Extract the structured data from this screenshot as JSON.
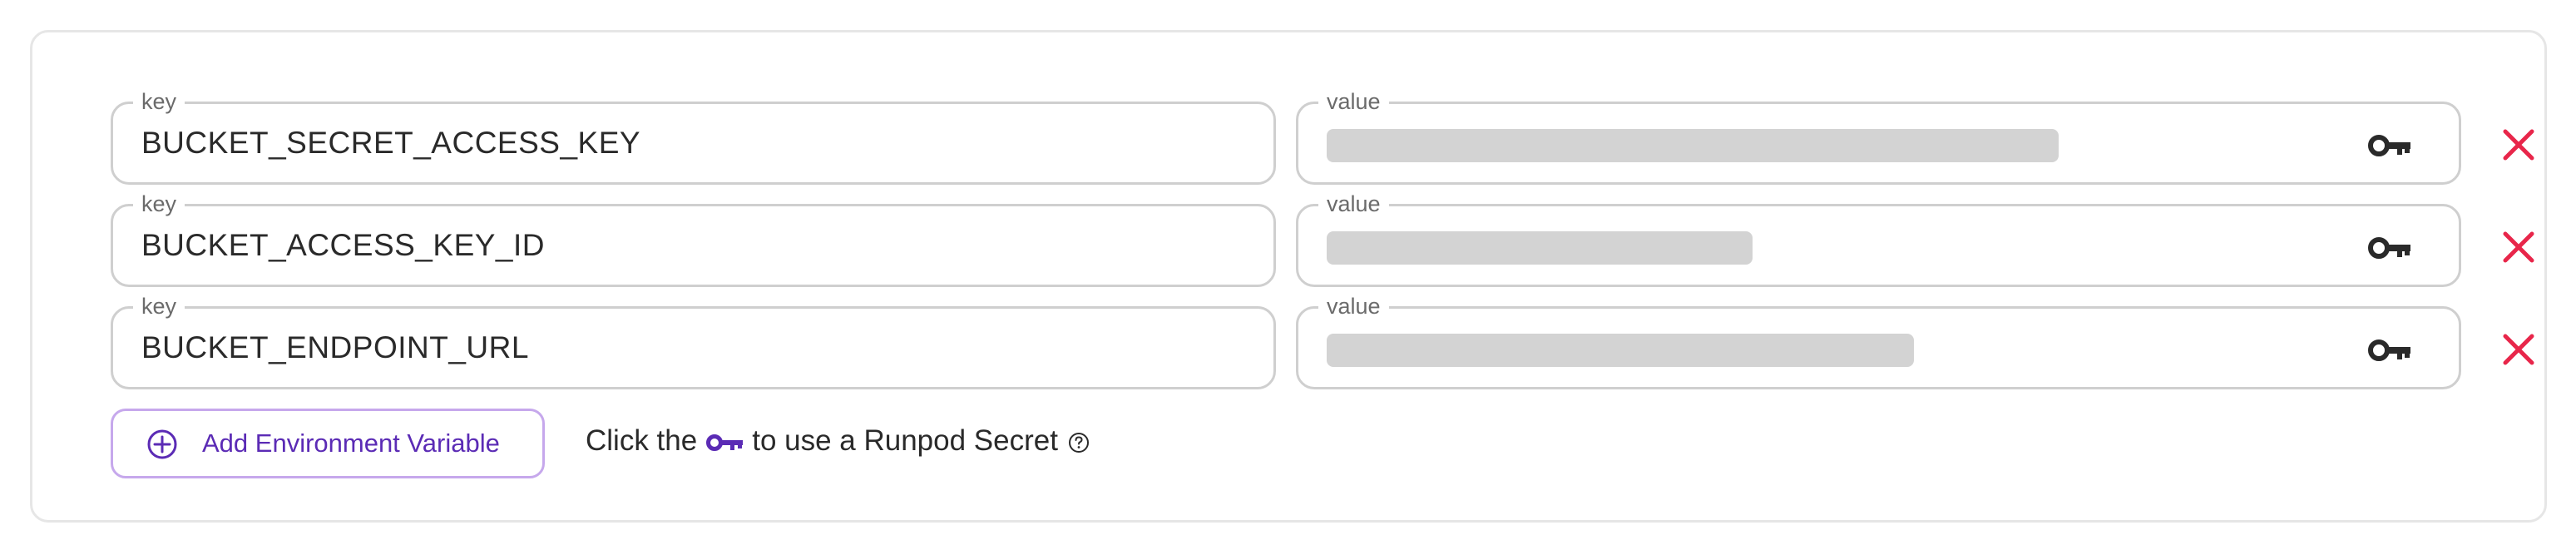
{
  "env_vars": [
    {
      "key_label": "key",
      "key_value": "BUCKET_SECRET_ACCESS_KEY",
      "value_label": "value",
      "value_redacted_fraction": 0.66
    },
    {
      "key_label": "key",
      "key_value": "BUCKET_ACCESS_KEY_ID",
      "value_label": "value",
      "value_redacted_fraction": 0.38
    },
    {
      "key_label": "key",
      "key_value": "BUCKET_ENDPOINT_URL",
      "value_label": "value",
      "value_redacted_fraction": 0.53
    }
  ],
  "add_button": {
    "label": "Add Environment Variable",
    "icon": "plus-circle-icon"
  },
  "hint": {
    "prefix": "Click the",
    "suffix": "to use a Runpod Secret",
    "key_icon": "key-icon",
    "help_icon": "help-circle-icon"
  },
  "icons": {
    "secret_key": "key-icon",
    "remove": "close-icon"
  },
  "colors": {
    "accent": "#5b2bb5",
    "accent_border": "#c6a8ec",
    "remove": "#e8264a",
    "field_border": "#cfcfcf",
    "redaction": "#d3d3d3"
  }
}
